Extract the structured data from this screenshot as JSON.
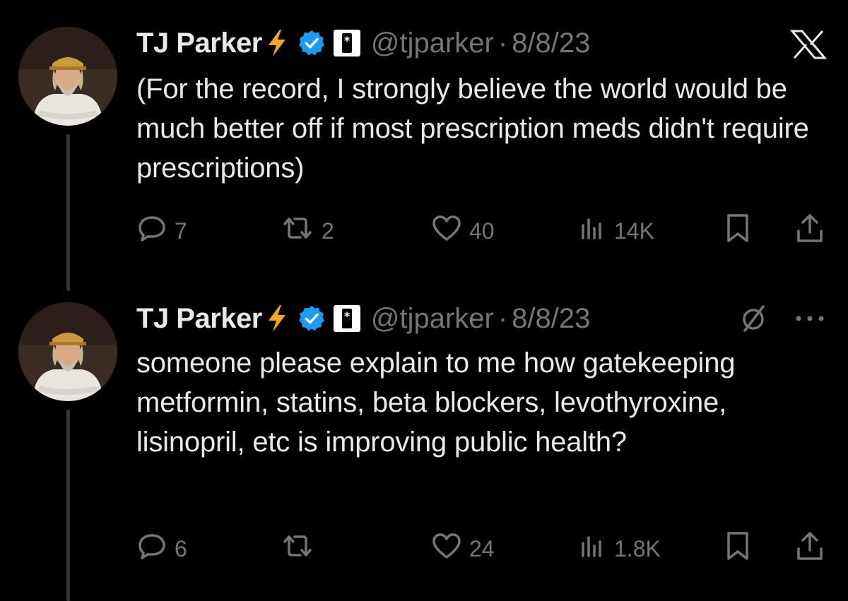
{
  "tweets": [
    {
      "name": "TJ Parker",
      "handle": "@tjparker",
      "separator": "·",
      "date": "8/8/23",
      "text": "(For the record, I strongly believe the world would be much better off if most prescription meds didn't require prescriptions)",
      "corner_icon": "x-logo-icon",
      "stats": {
        "replies": "7",
        "reposts": "2",
        "likes": "40",
        "views": "14K"
      }
    },
    {
      "name": "TJ Parker",
      "handle": "@tjparker",
      "separator": "·",
      "date": "8/8/23",
      "text": "someone please explain to me how gatekeeping metformin, statins, beta blockers, levothyroxine, lisinopril, etc is improving public health?",
      "corner_icon": "grok-icon",
      "stats": {
        "replies": "6",
        "reposts": "",
        "likes": "24",
        "views": "1.8K"
      }
    }
  ],
  "icons": [
    "lightning-icon",
    "verified-badge-icon",
    "affiliate-badge-icon",
    "reply-icon",
    "repost-icon",
    "like-icon",
    "views-icon",
    "bookmark-icon",
    "share-icon",
    "more-icon"
  ],
  "colors": {
    "background": "#000000",
    "text": "#e7e9ea",
    "muted": "#71767b",
    "verified": "#1d9bf0",
    "bolt": "#f5a623",
    "thread_line": "#333639"
  }
}
